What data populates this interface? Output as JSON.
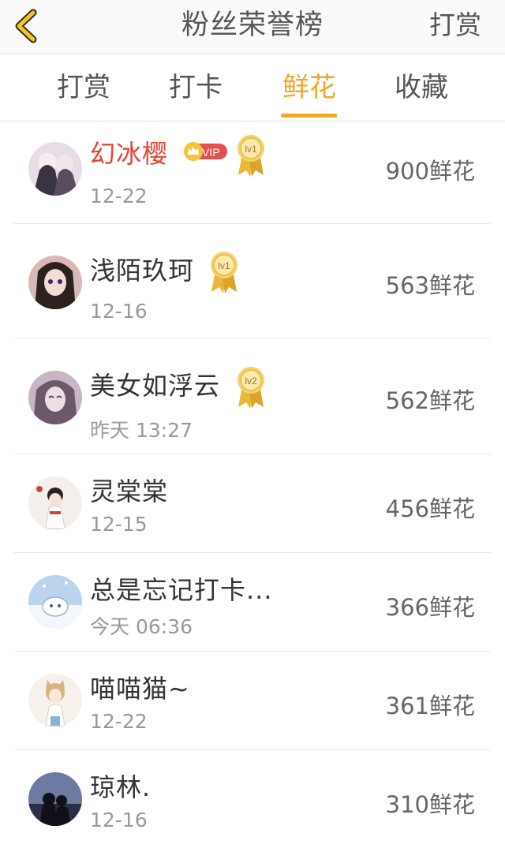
{
  "header": {
    "title": "粉丝荣誉榜",
    "action_label": "打赏",
    "back_icon": "chevron-left-icon"
  },
  "tabs": [
    {
      "label": "打赏",
      "active": false
    },
    {
      "label": "打卡",
      "active": false
    },
    {
      "label": "鲜花",
      "active": true
    },
    {
      "label": "收藏",
      "active": false
    }
  ],
  "colors": {
    "accent": "#f5a623",
    "vip_name": "#e2452f",
    "vip_badge": "#e25050",
    "medal_gold": "#e8b93a"
  },
  "fans": [
    {
      "name": "幻冰樱",
      "date": "12-22",
      "amount": "900鲜花",
      "vip": true,
      "vip_label": "VIP",
      "level": "lv1",
      "avatar_colors": [
        "#e8dde6",
        "#3a3340"
      ]
    },
    {
      "name": "浅陌玖珂",
      "date": "12-16",
      "amount": "563鲜花",
      "vip": false,
      "level": "lv1",
      "avatar_colors": [
        "#d8b9b6",
        "#2b211f"
      ]
    },
    {
      "name": "美女如浮云",
      "date": "昨天 13:27",
      "amount": "562鲜花",
      "vip": false,
      "level": "lv2",
      "avatar_colors": [
        "#c9b6c4",
        "#6b5868"
      ]
    },
    {
      "name": "灵棠棠",
      "date": "12-15",
      "amount": "456鲜花",
      "vip": false,
      "level": "",
      "avatar_colors": [
        "#f4efec",
        "#c44a3c"
      ]
    },
    {
      "name": "总是忘记打卡...",
      "date": "今天 06:36",
      "amount": "366鲜花",
      "vip": false,
      "level": "",
      "avatar_colors": [
        "#bcd3ee",
        "#f3f6fb"
      ]
    },
    {
      "name": "喵喵猫~",
      "date": "12-22",
      "amount": "361鲜花",
      "vip": false,
      "level": "",
      "avatar_colors": [
        "#f6f1ea",
        "#d8b37a"
      ]
    },
    {
      "name": "琼林.",
      "date": "12-16",
      "amount": "310鲜花",
      "vip": false,
      "level": "",
      "avatar_colors": [
        "#6f7aa3",
        "#101018"
      ]
    }
  ]
}
